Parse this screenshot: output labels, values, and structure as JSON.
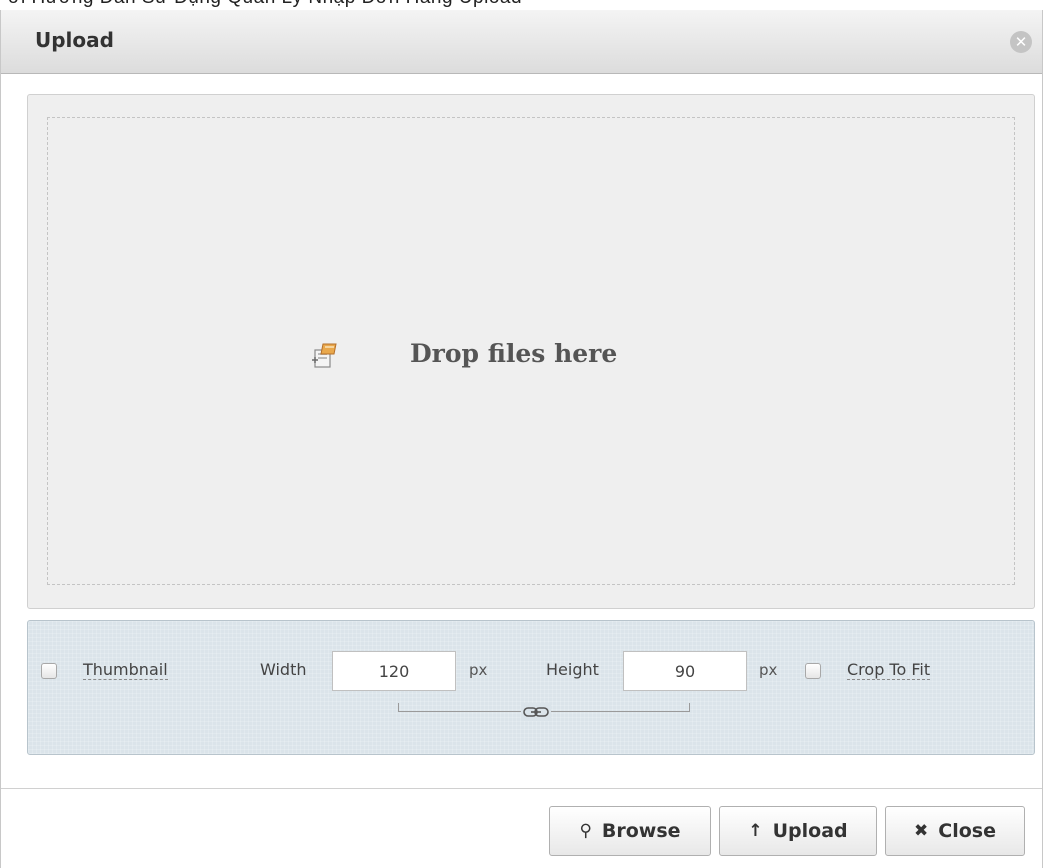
{
  "background_text": "ời Hưởng Dẫn Sử Dụng Quản Lý Nhập Đơn Hàng Upload",
  "dialog": {
    "title": "Upload",
    "close_icon": "close-circle-icon"
  },
  "dropzone": {
    "icon": "upload-file-icon",
    "text": "Drop files here"
  },
  "options": {
    "thumbnail_label": "Thumbnail",
    "thumbnail_checked": false,
    "width_label": "Width",
    "width_value": "120",
    "width_unit": "px",
    "height_label": "Height",
    "height_value": "90",
    "height_unit": "px",
    "crop_label": "Crop To Fit",
    "crop_checked": false,
    "link_icon": "chain-link-icon"
  },
  "footer": {
    "browse_label": "Browse",
    "browse_icon": "search-icon",
    "upload_label": "Upload",
    "upload_icon": "arrow-up-icon",
    "close_label": "Close",
    "close_icon": "x-icon"
  },
  "colors": {
    "options_panel_bg": "#dbe4ea",
    "dropzone_bg": "#efefef",
    "title_text": "#333333"
  }
}
